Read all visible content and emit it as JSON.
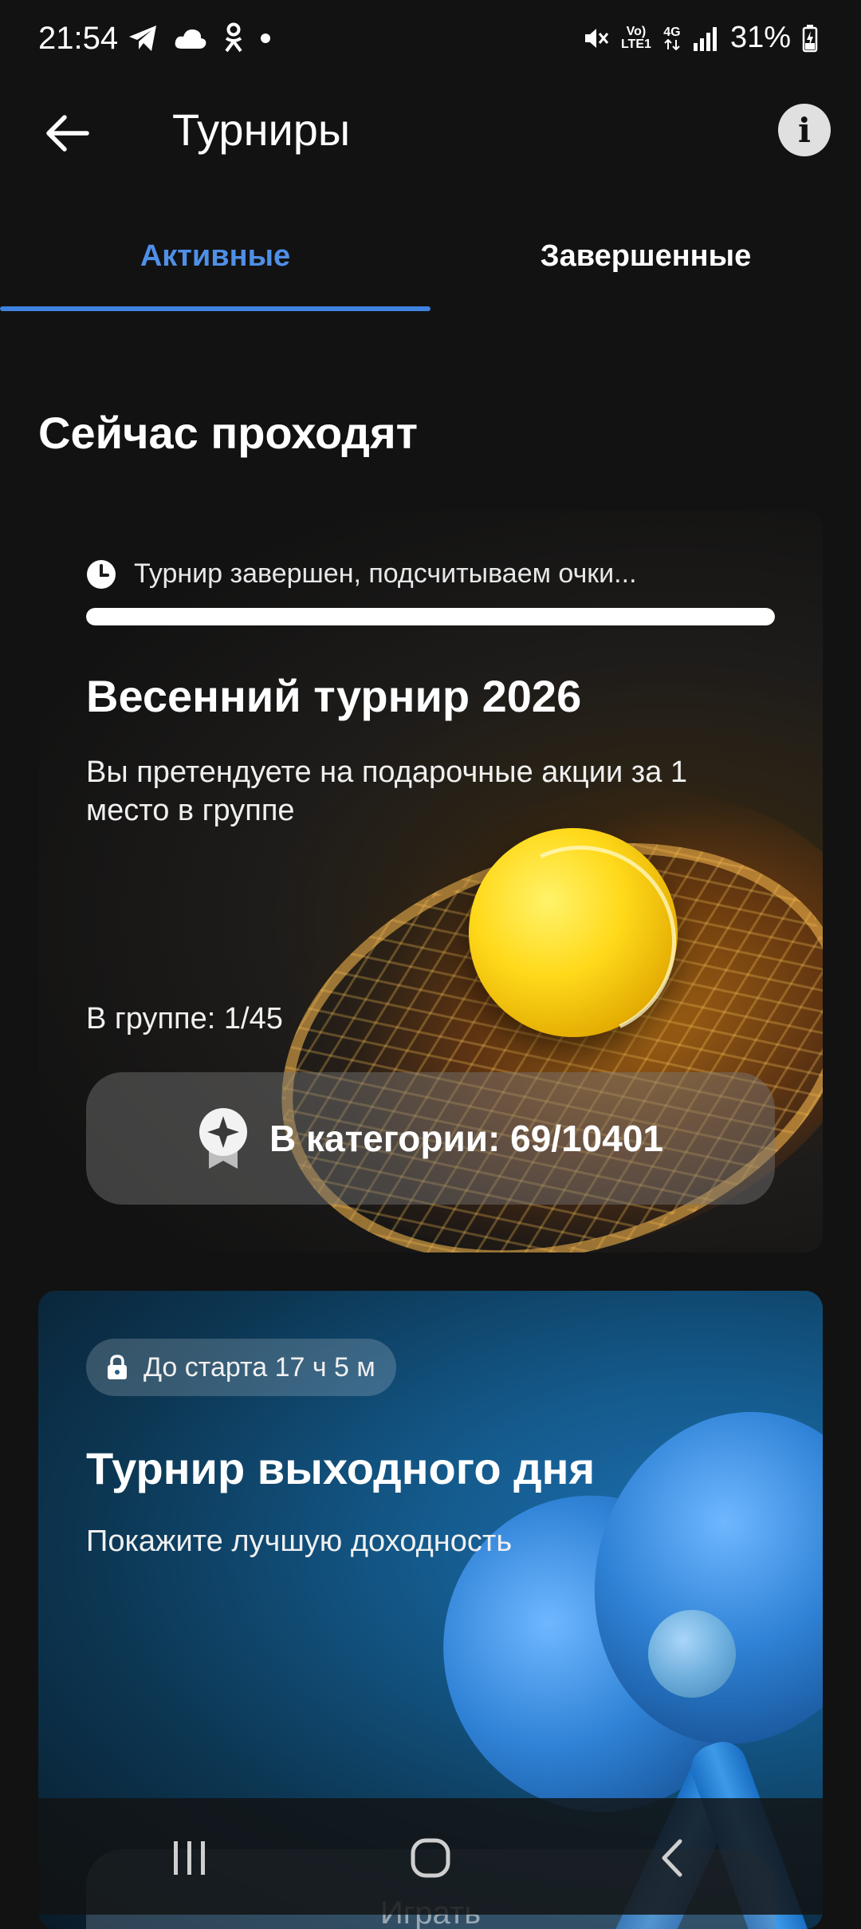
{
  "status_bar": {
    "time": "21:54",
    "network_label_1": "Vo) LTE1",
    "network_label_2": "4G",
    "battery": "31%"
  },
  "app_bar": {
    "title": "Турниры",
    "back_icon": "arrow-left-icon",
    "info_icon": "info-icon"
  },
  "tabs": [
    {
      "label": "Активные",
      "active": true
    },
    {
      "label": "Завершенные",
      "active": false
    }
  ],
  "section_heading": "Сейчас проходят",
  "tournaments": [
    {
      "status_text": "Турнир завершен, подсчитываем очки...",
      "progress": 1.0,
      "title": "Весенний турнир 2026",
      "description": "Вы претендуете на подарочные акции за 1 место в группе",
      "group_rank": "В группе: 1/45",
      "category_rank": "В категории: 69/10401"
    },
    {
      "countdown": "До старта 17 ч 5 м",
      "title": "Турнир выходного дня",
      "description": "Покажите лучшую доходность",
      "button_label": "Играть"
    }
  ],
  "colors": {
    "accent": "#3f82e0",
    "background": "#121212"
  }
}
